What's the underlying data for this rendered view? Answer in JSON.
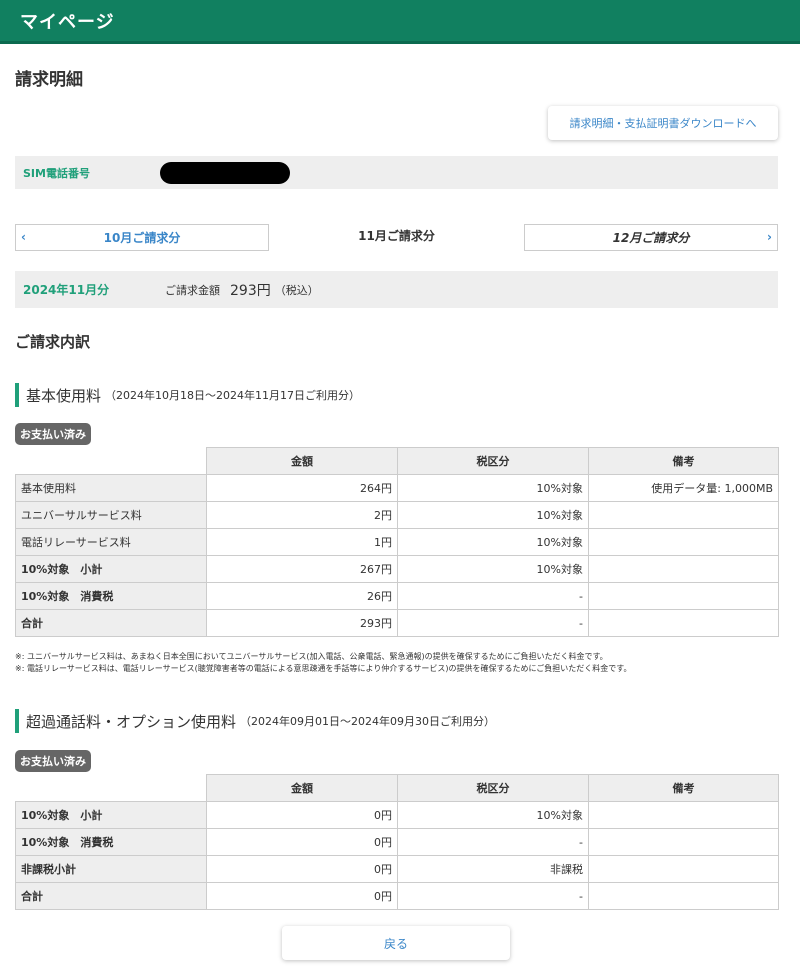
{
  "header": {
    "title": "マイページ"
  },
  "page": {
    "title": "請求明細"
  },
  "download_button": "請求明細・支払証明書ダウンロードへ",
  "sim": {
    "label": "SIM電話番号"
  },
  "month_nav": {
    "prev": "10月ご請求分",
    "current": "11月ご請求分",
    "next": "12月ご請求分",
    "prev_icon": "‹",
    "next_icon": "›"
  },
  "summary": {
    "month": "2024年11月分",
    "label": "ご請求金額",
    "amount": "293円",
    "tax": "（税込）"
  },
  "breakdown_title": "ご請求内訳",
  "basic": {
    "title": "基本使用料",
    "period": "（2024年10月18日〜2024年11月17日ご利用分）",
    "badge": "お支払い済み",
    "headers": [
      "金額",
      "税区分",
      "備考"
    ],
    "rows": [
      {
        "label": "基本使用料",
        "amount": "264円",
        "tax": "10%対象",
        "note": "使用データ量: 1,000MB"
      },
      {
        "label": "ユニバーサルサービス料",
        "amount": "2円",
        "tax": "10%対象",
        "note": ""
      },
      {
        "label": "電話リレーサービス料",
        "amount": "1円",
        "tax": "10%対象",
        "note": ""
      },
      {
        "label": "10%対象　小計",
        "amount": "267円",
        "tax": "10%対象",
        "note": ""
      },
      {
        "label": "10%対象　消費税",
        "amount": "26円",
        "tax": "-",
        "note": ""
      },
      {
        "label": "合計",
        "amount": "293円",
        "tax": "-",
        "note": ""
      }
    ]
  },
  "footnotes": [
    "※: ユニバーサルサービス料は、あまねく日本全国においてユニバーサルサービス(加入電話、公衆電話、緊急通報)の提供を確保するためにご負担いただく料金です。",
    "※: 電話リレーサービス料は、電話リレーサービス(聴覚障害者等の電話による意思疎通を手話等により仲介するサービス)の提供を確保するためにご負担いただく料金です。"
  ],
  "overage": {
    "title": "超過通話料・オプション使用料",
    "period": "（2024年09月01日〜2024年09月30日ご利用分）",
    "badge": "お支払い済み",
    "headers": [
      "金額",
      "税区分",
      "備考"
    ],
    "rows": [
      {
        "label": "10%対象　小計",
        "amount": "0円",
        "tax": "10%対象",
        "note": ""
      },
      {
        "label": "10%対象　消費税",
        "amount": "0円",
        "tax": "-",
        "note": ""
      },
      {
        "label": "非課税小計",
        "amount": "0円",
        "tax": "非課税",
        "note": ""
      },
      {
        "label": "合計",
        "amount": "0円",
        "tax": "-",
        "note": ""
      }
    ]
  },
  "back_button": "戻る"
}
